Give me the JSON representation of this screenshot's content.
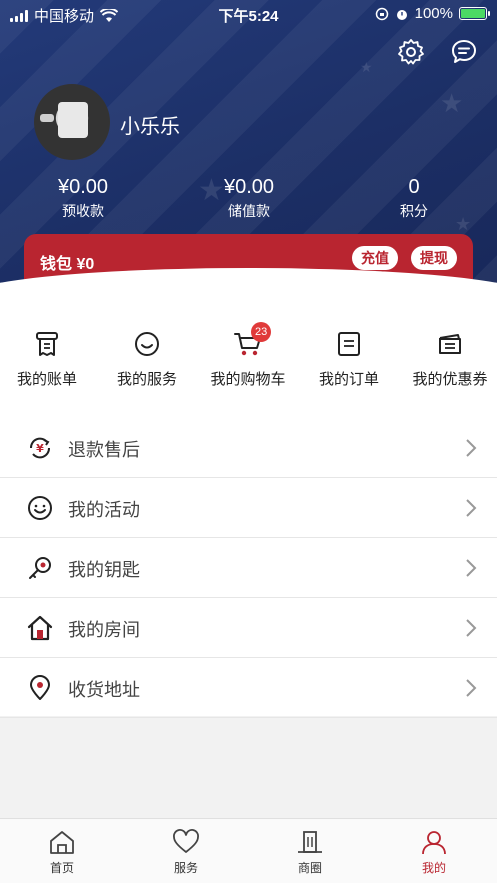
{
  "status_bar": {
    "carrier": "中国移动",
    "time": "下午5:24",
    "battery": "100%"
  },
  "profile": {
    "username": "小乐乐"
  },
  "stats": [
    {
      "value": "¥0.00",
      "label": "预收款"
    },
    {
      "value": "¥0.00",
      "label": "储值款"
    },
    {
      "value": "0",
      "label": "积分"
    }
  ],
  "wallet": {
    "label": "钱包 ¥0",
    "recharge": "充值",
    "withdraw": "提现"
  },
  "quick_actions": [
    {
      "label": "我的账单",
      "icon": "bill-icon"
    },
    {
      "label": "我的服务",
      "icon": "smile-icon"
    },
    {
      "label": "我的购物车",
      "icon": "cart-icon",
      "badge": "23"
    },
    {
      "label": "我的订单",
      "icon": "order-icon"
    },
    {
      "label": "我的优惠券",
      "icon": "coupon-icon"
    }
  ],
  "menu": [
    {
      "label": "退款售后",
      "icon": "refund-icon"
    },
    {
      "label": "我的活动",
      "icon": "activity-icon"
    },
    {
      "label": "我的钥匙",
      "icon": "key-icon"
    },
    {
      "label": "我的房间",
      "icon": "house-icon"
    },
    {
      "label": "收货地址",
      "icon": "location-icon"
    }
  ],
  "tabs": [
    {
      "label": "首页",
      "icon": "home-icon"
    },
    {
      "label": "服务",
      "icon": "heart-icon"
    },
    {
      "label": "商圈",
      "icon": "building-icon"
    },
    {
      "label": "我的",
      "icon": "user-icon",
      "active": true
    }
  ],
  "colors": {
    "header_bg": "#1c2f66",
    "accent_red": "#b92530",
    "badge_red": "#e03a3a"
  }
}
